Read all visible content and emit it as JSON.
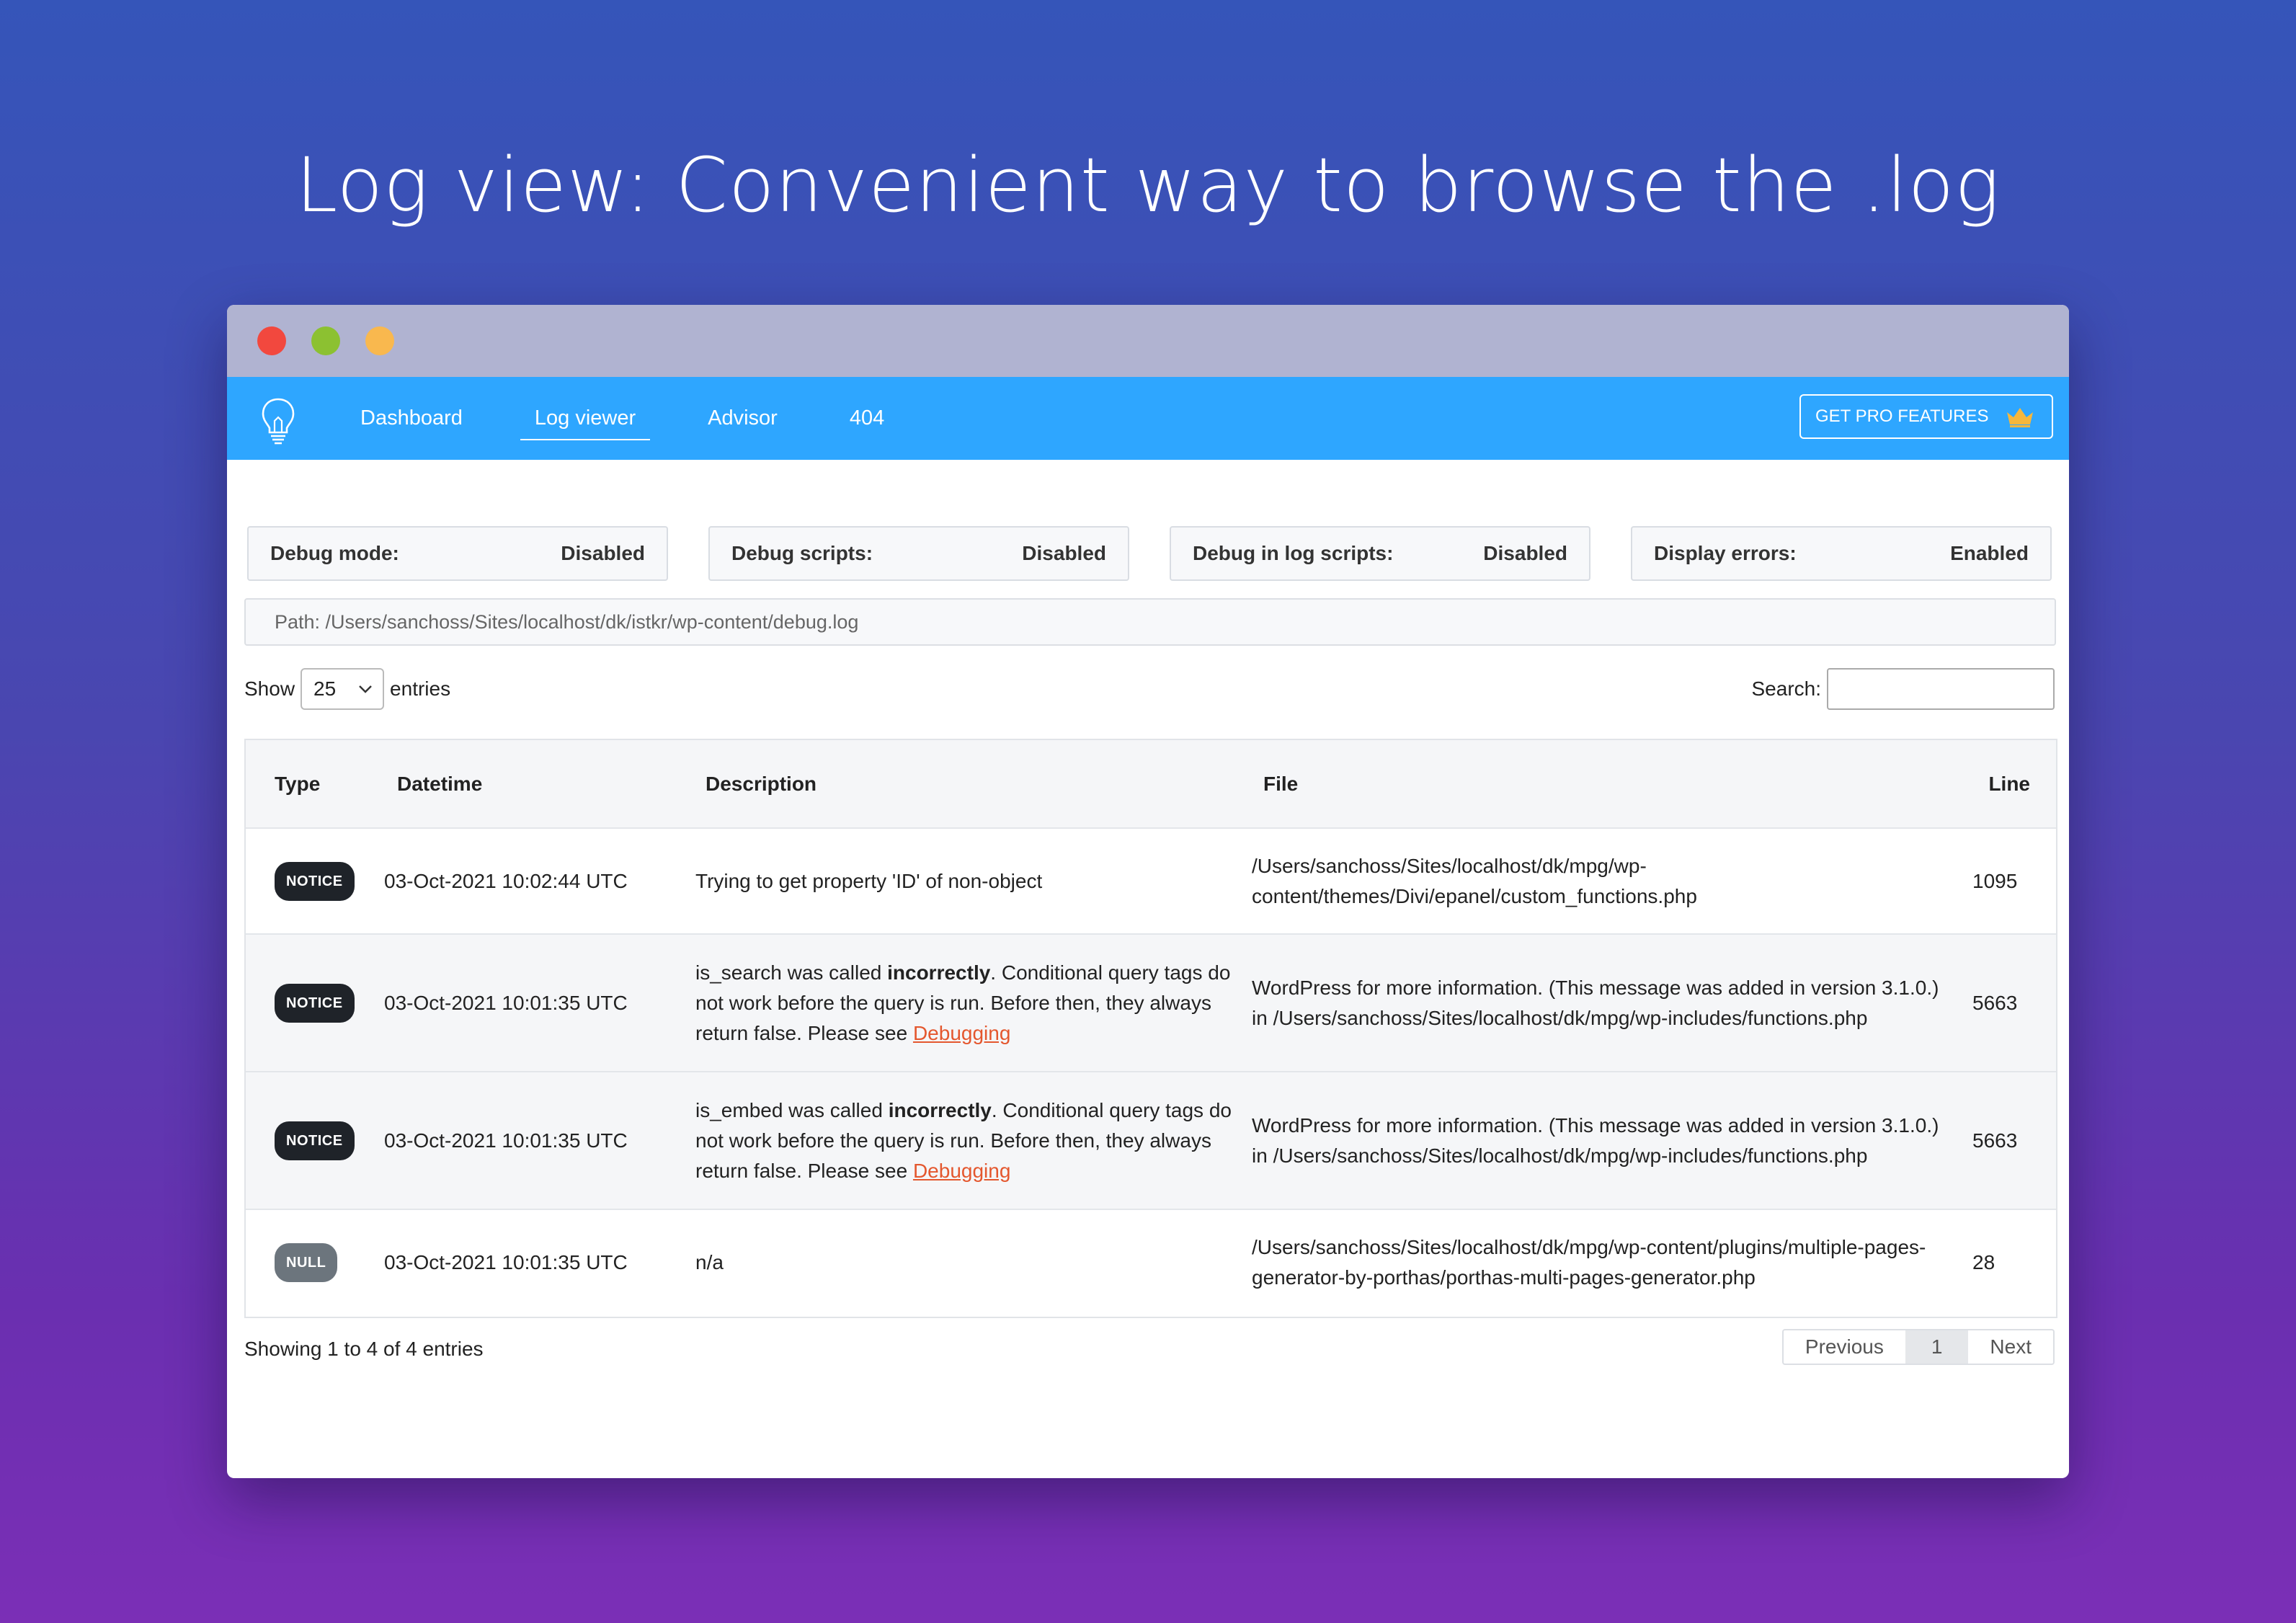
{
  "hero": {
    "title": "Log view: Convenient way to browse the .log"
  },
  "nav": {
    "items": [
      "Dashboard",
      "Log viewer",
      "Advisor",
      "404"
    ],
    "active": "Log viewer",
    "pro_label": "GET PRO FEATURES"
  },
  "status": [
    {
      "label": "Debug mode:",
      "value": "Disabled"
    },
    {
      "label": "Debug scripts:",
      "value": "Disabled"
    },
    {
      "label": "Debug in log scripts:",
      "value": "Disabled"
    },
    {
      "label": "Display errors:",
      "value": "Enabled"
    }
  ],
  "path": "Path: /Users/sanchoss/Sites/localhost/dk/istkr/wp-content/debug.log",
  "controls": {
    "show_label": "Show",
    "entries_value": "25",
    "entries_label": "entries",
    "search_label": "Search:"
  },
  "table": {
    "headers": [
      "Type",
      "Datetime",
      "Description",
      "File",
      "Line"
    ],
    "rows": [
      {
        "type": "NOTICE",
        "datetime": "03-Oct-2021 10:02:44 UTC",
        "desc_pre": "Trying to get property 'ID' of non-object",
        "desc_bold": "",
        "desc_post": "",
        "desc_link": "",
        "file": "/Users/sanchoss/Sites/localhost/dk/mpg/wp-content/themes/Divi/epanel/custom_functions.php",
        "line": "1095"
      },
      {
        "type": "NOTICE",
        "datetime": "03-Oct-2021 10:01:35 UTC",
        "desc_pre": "is_search was called ",
        "desc_bold": "incorrectly",
        "desc_post": ". Conditional query tags do not work before the query is run. Before then, they always return false. Please see ",
        "desc_link": "Debugging",
        "file": "WordPress for more information. (This message was added in version 3.1.0.) in /Users/sanchoss/Sites/localhost/dk/mpg/wp-includes/functions.php",
        "line": "5663"
      },
      {
        "type": "NOTICE",
        "datetime": "03-Oct-2021 10:01:35 UTC",
        "desc_pre": "is_embed was called ",
        "desc_bold": "incorrectly",
        "desc_post": ". Conditional query tags do not work before the query is run. Before then, they always return false. Please see ",
        "desc_link": "Debugging",
        "file": "WordPress for more information. (This message was added in version 3.1.0.) in /Users/sanchoss/Sites/localhost/dk/mpg/wp-includes/functions.php",
        "line": "5663"
      },
      {
        "type": "NULL",
        "datetime": "03-Oct-2021 10:01:35 UTC",
        "desc_pre": "n/a",
        "desc_bold": "",
        "desc_post": "",
        "desc_link": "",
        "file": "/Users/sanchoss/Sites/localhost/dk/mpg/wp-content/plugins/multiple-pages-generator-by-porthas/porthas-multi-pages-generator.php",
        "line": "28"
      }
    ]
  },
  "footer": {
    "info": "Showing 1 to 4 of 4 entries",
    "prev": "Previous",
    "page": "1",
    "next": "Next"
  },
  "colors": {
    "nav_bg": "#2ea6ff",
    "titlebar": "#b0b3d1",
    "badge_notice": "#1f2329",
    "badge_null": "#6c757d",
    "link": "#e4572e"
  },
  "icons": [
    "lightbulb-icon",
    "crown-icon",
    "chevron-down-icon"
  ]
}
